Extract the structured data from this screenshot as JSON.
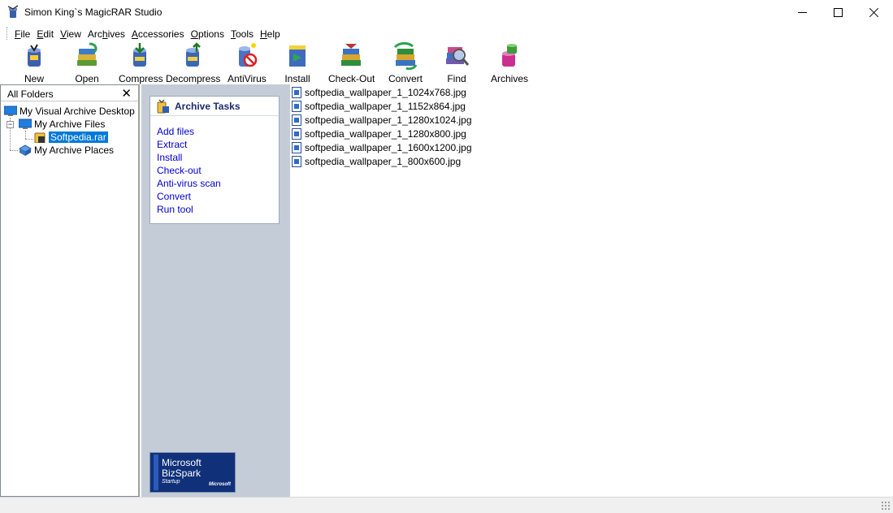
{
  "window": {
    "title": "Simon King`s MagicRAR Studio"
  },
  "menu": [
    {
      "mnemonic": "F",
      "rest": "ile"
    },
    {
      "mnemonic": "E",
      "rest": "dit"
    },
    {
      "mnemonic": "V",
      "rest": "iew"
    },
    {
      "pre": "Arc",
      "mnemonic": "h",
      "rest": "ives"
    },
    {
      "mnemonic": "A",
      "rest": "ccessories"
    },
    {
      "mnemonic": "O",
      "rest": "ptions"
    },
    {
      "mnemonic": "T",
      "rest": "ools"
    },
    {
      "mnemonic": "H",
      "rest": "elp"
    }
  ],
  "toolbar": {
    "new": "New",
    "open": "Open",
    "compress": "Compress",
    "decompress": "Decompress",
    "antivirus": "AntiVirus",
    "install": "Install",
    "checkout": "Check-Out",
    "convert": "Convert",
    "find": "Find",
    "archives": "Archives"
  },
  "folders": {
    "header": "All Folders",
    "close": "✕",
    "root": "My Visual Archive Desktop",
    "archive_files": "My Archive Files",
    "selected": "Softpedia.rar",
    "archive_places": "My Archive Places",
    "expander_minus": "−",
    "expander_plus": "+"
  },
  "tasks": {
    "title": "Archive Tasks",
    "links": [
      "Add files",
      "Extract",
      "Install",
      "Check-out",
      "Anti-virus scan",
      "Convert",
      "Run tool"
    ]
  },
  "promo": {
    "line1": "Microsoft",
    "line2": "BizSpark",
    "line3": "Startup",
    "brand": "Microsoft"
  },
  "files": [
    "softpedia_wallpaper_1_1024x768.jpg",
    "softpedia_wallpaper_1_1152x864.jpg",
    "softpedia_wallpaper_1_1280x1024.jpg",
    "softpedia_wallpaper_1_1280x800.jpg",
    "softpedia_wallpaper_1_1600x1200.jpg",
    "softpedia_wallpaper_1_800x600.jpg"
  ],
  "colors": {
    "task_pane_bg": "#c4ccd7",
    "selection": "#0078d7",
    "link": "#0000cc",
    "task_title": "#1b2a6b"
  }
}
